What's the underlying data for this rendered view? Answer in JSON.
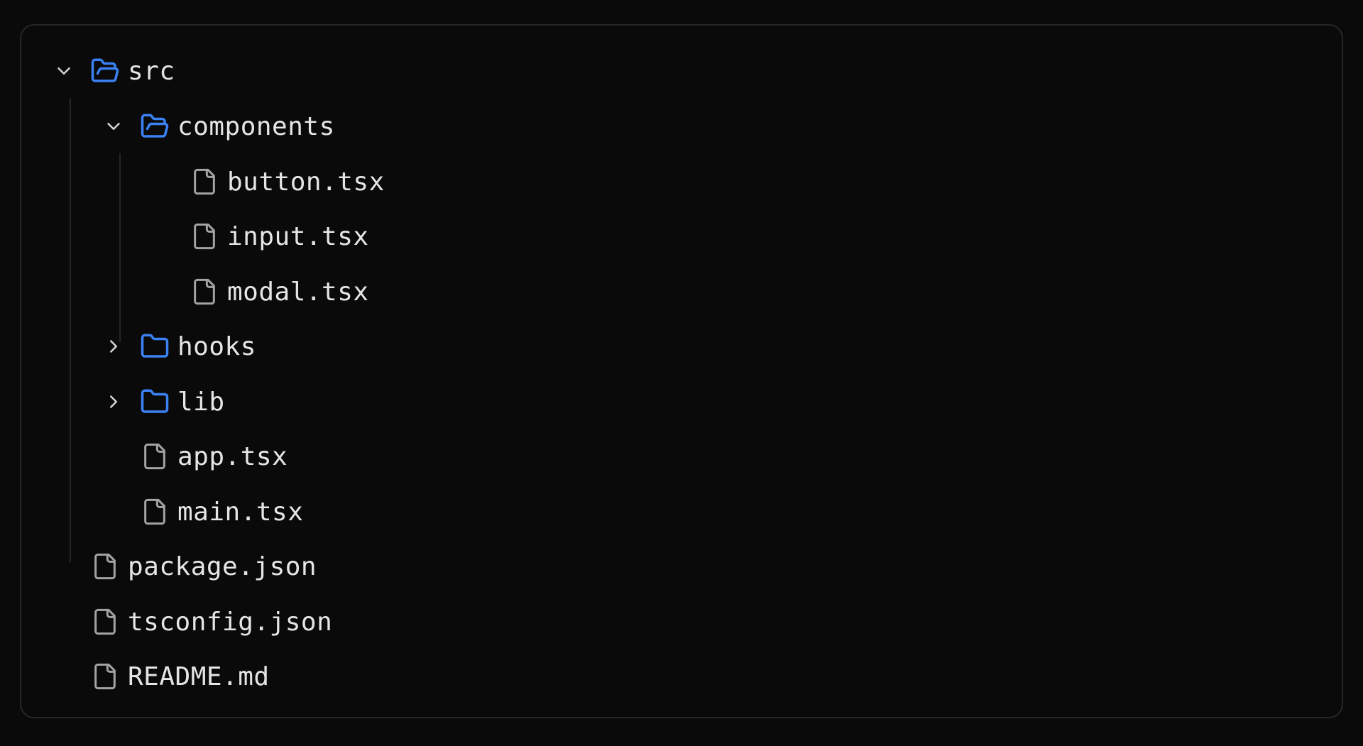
{
  "colors": {
    "background": "#0a0a0a",
    "border": "#262626",
    "folder": "#3b82f6",
    "file": "#a3a3a3",
    "text": "#e5e5e5"
  },
  "tree": {
    "src": {
      "label": "src",
      "icon": "folder-open-icon",
      "expanded": true
    },
    "components": {
      "label": "components",
      "icon": "folder-open-icon",
      "expanded": true
    },
    "button": {
      "label": "button.tsx",
      "icon": "file-icon"
    },
    "input": {
      "label": "input.tsx",
      "icon": "file-icon"
    },
    "modal": {
      "label": "modal.tsx",
      "icon": "file-icon"
    },
    "hooks": {
      "label": "hooks",
      "icon": "folder-icon",
      "expanded": false
    },
    "lib": {
      "label": "lib",
      "icon": "folder-icon",
      "expanded": false
    },
    "app": {
      "label": "app.tsx",
      "icon": "file-icon"
    },
    "main": {
      "label": "main.tsx",
      "icon": "file-icon"
    },
    "package": {
      "label": "package.json",
      "icon": "file-icon"
    },
    "tsconfig": {
      "label": "tsconfig.json",
      "icon": "file-icon"
    },
    "readme": {
      "label": "README.md",
      "icon": "file-icon"
    }
  }
}
